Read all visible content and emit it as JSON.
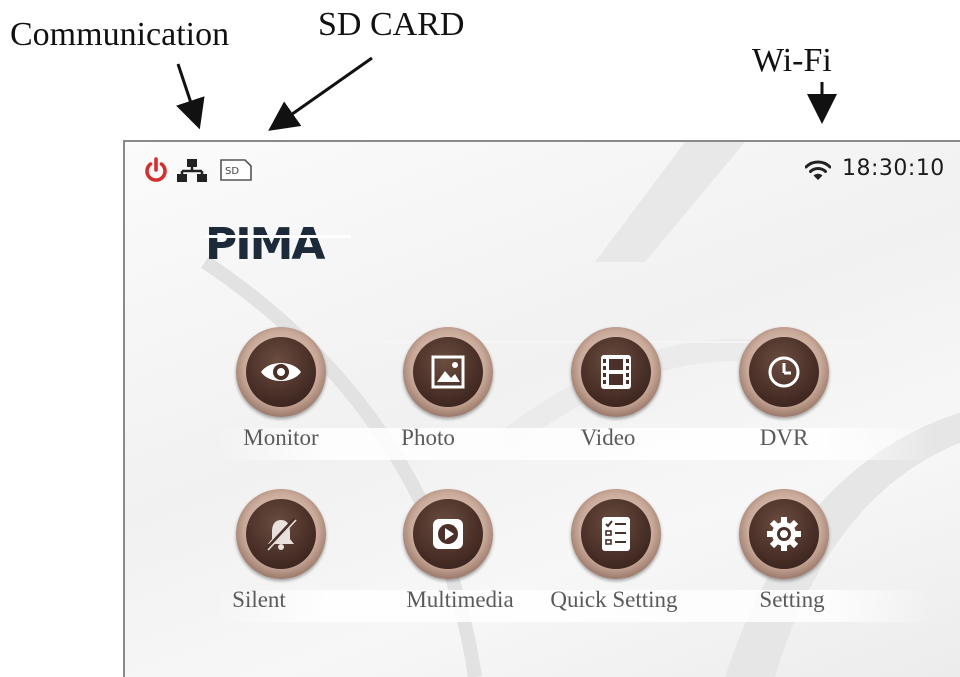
{
  "callouts": {
    "communication": "Communication",
    "sd_card": "SD CARD",
    "wifi": "Wi-Fi"
  },
  "statusbar": {
    "icons": [
      "power-icon",
      "network-icon",
      "sd-card-icon",
      "wifi-icon"
    ],
    "power_color": "#d32f2f",
    "sd_label": "SD",
    "time": "18:30:10"
  },
  "brand": {
    "logo_text": "PIMA"
  },
  "menu": {
    "items": [
      {
        "label": "Monitor",
        "icon": "eye-icon"
      },
      {
        "label": "Photo",
        "icon": "image-icon"
      },
      {
        "label": "Video",
        "icon": "film-icon"
      },
      {
        "label": "DVR",
        "icon": "clock-icon"
      },
      {
        "label": "Silent",
        "icon": "bell-off-icon"
      },
      {
        "label": "Multimedia",
        "icon": "play-icon"
      },
      {
        "label": "Quick Setting",
        "icon": "checklist-icon"
      },
      {
        "label": "Setting",
        "icon": "gear-icon"
      }
    ]
  },
  "colors": {
    "button_inner": "#4a3028",
    "button_ring": "#c9a999",
    "label_text": "#5a5a5a",
    "icon_white": "#ffffff"
  }
}
